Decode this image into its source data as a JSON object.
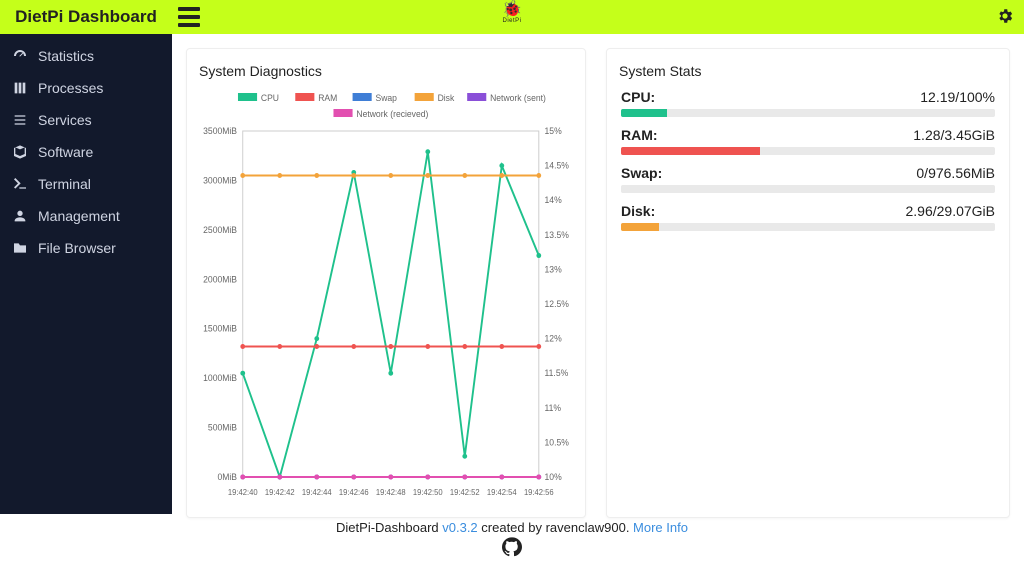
{
  "brand": "DietPi Dashboard",
  "sidebar": {
    "items": [
      {
        "label": "Statistics"
      },
      {
        "label": "Processes"
      },
      {
        "label": "Services"
      },
      {
        "label": "Software"
      },
      {
        "label": "Terminal"
      },
      {
        "label": "Management"
      },
      {
        "label": "File Browser"
      }
    ]
  },
  "logo_text": "DietPi",
  "diag": {
    "title": "System Diagnostics",
    "legend": {
      "cpu": "CPU",
      "ram": "RAM",
      "swap": "Swap",
      "disk": "Disk",
      "net_sent": "Network (sent)",
      "net_recv": "Network (recieved)"
    }
  },
  "stats": {
    "title": "System Stats",
    "rows": [
      {
        "label": "CPU:",
        "value": "12.19/100%",
        "pct": 12.19,
        "color": "#1fc18c"
      },
      {
        "label": "RAM:",
        "value": "1.28/3.45GiB",
        "pct": 37.1,
        "color": "#ef5350"
      },
      {
        "label": "Swap:",
        "value": "0/976.56MiB",
        "pct": 0,
        "color": "#3f7ed6"
      },
      {
        "label": "Disk:",
        "value": "2.96/29.07GiB",
        "pct": 10.2,
        "color": "#f3a33a"
      }
    ]
  },
  "footer": {
    "pre": "DietPi-Dashboard ",
    "version": "v0.3.2",
    "mid": " created by ravenclaw900. ",
    "more": "More Info"
  },
  "chart_data": {
    "type": "line",
    "x": [
      "19:42:40",
      "19:42:42",
      "19:42:44",
      "19:42:46",
      "19:42:48",
      "19:42:50",
      "19:42:52",
      "19:42:54",
      "19:42:56"
    ],
    "y_left_label": "MiB",
    "y_left_ticks": [
      0,
      500,
      1000,
      1500,
      2000,
      2500,
      3000,
      3500
    ],
    "y_right_label": "%",
    "y_right_ticks": [
      10,
      10.5,
      11,
      11.5,
      12,
      12.5,
      13,
      13.5,
      14,
      14.5,
      15
    ],
    "series": [
      {
        "name": "CPU",
        "axis": "right",
        "color": "#1fc18c",
        "values": [
          11.5,
          10.0,
          12.0,
          14.4,
          11.5,
          14.7,
          10.3,
          14.5,
          13.2
        ]
      },
      {
        "name": "RAM",
        "axis": "left",
        "color": "#ef5350",
        "values": [
          1320,
          1320,
          1320,
          1320,
          1320,
          1320,
          1320,
          1320,
          1320
        ]
      },
      {
        "name": "Swap",
        "axis": "left",
        "color": "#3f7ed6",
        "values": [
          0,
          0,
          0,
          0,
          0,
          0,
          0,
          0,
          0
        ]
      },
      {
        "name": "Disk",
        "axis": "left",
        "color": "#f3a33a",
        "values": [
          3050,
          3050,
          3050,
          3050,
          3050,
          3050,
          3050,
          3050,
          3050
        ]
      },
      {
        "name": "Network (sent)",
        "axis": "left",
        "color": "#8a4fd8",
        "values": [
          0,
          0,
          0,
          0,
          0,
          0,
          0,
          0,
          0
        ]
      },
      {
        "name": "Network (recieved)",
        "axis": "left",
        "color": "#e24fb0",
        "values": [
          0,
          0,
          0,
          0,
          0,
          0,
          0,
          0,
          0
        ]
      }
    ]
  }
}
